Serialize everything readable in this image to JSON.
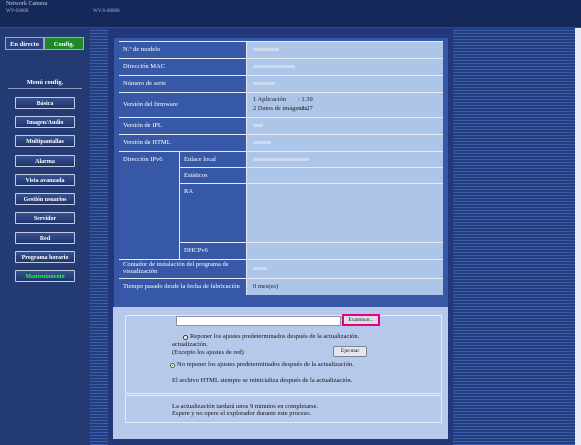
{
  "header": {
    "camera_title": "Network Camera",
    "model": "WV-S6000",
    "ip": "WV-S-00000"
  },
  "tabs": {
    "live": "En directo",
    "config": "Config."
  },
  "menu": {
    "title": "Menú config.",
    "items": [
      "Básica",
      "Imagen/Audio",
      "Multipantallas",
      "Alarma",
      "Vista avanzada",
      "Gestión usuarios",
      "Servidor",
      "Red",
      "Programa horario",
      "Mantenimiento"
    ],
    "active": "Mantenimiento"
  },
  "info": {
    "model_label": "N.º de modelo",
    "mac_label": "Dirección MAC",
    "serial_label": "Número de serie",
    "firmware_label": "Versión del firmware",
    "firmware_app_label": "1 Aplicación",
    "firmware_app_value": ": 1.39",
    "firmware_img_label": "2 Datos de imágenes",
    "firmware_img_value": ": 2.27",
    "ipl_label": "Versión de IPL",
    "html_label": "Versión de HTML",
    "ipv6_label": "Dirección IPv6",
    "link_local_label": "Enlace local",
    "static_label": "Estáticos",
    "ra_label": "RA",
    "dhcpv6_label": "DHCPv6",
    "viewer_counter_label": "Contador de instalación del programa de visualización",
    "elapsed_label": "Tiempo pasado desde la fecha de fabricación",
    "elapsed_value": "0 mes(es)"
  },
  "update": {
    "browse_label": "Examinar...",
    "radio_reset_label": "Reponer los ajustes predeterminados después de la actualización.",
    "radio_reset_note": "(Excepto los ajustes de red)",
    "execute_label": "Ejecutar",
    "radio_keep_label": "No reponer los ajustes predeterminados después de la actualización.",
    "html_note": "El archivo HTML siempre se reinicializa después de la actualización.",
    "time_note_1": "La actualización tardará unos 9 minutos en completarse.",
    "time_note_2": "Espere y no opere el explorador durante este proceso."
  },
  "colors": {
    "active_tab": "#1c8a25",
    "highlight": "#e5007e",
    "active_menu_text": "#1aff3a"
  }
}
